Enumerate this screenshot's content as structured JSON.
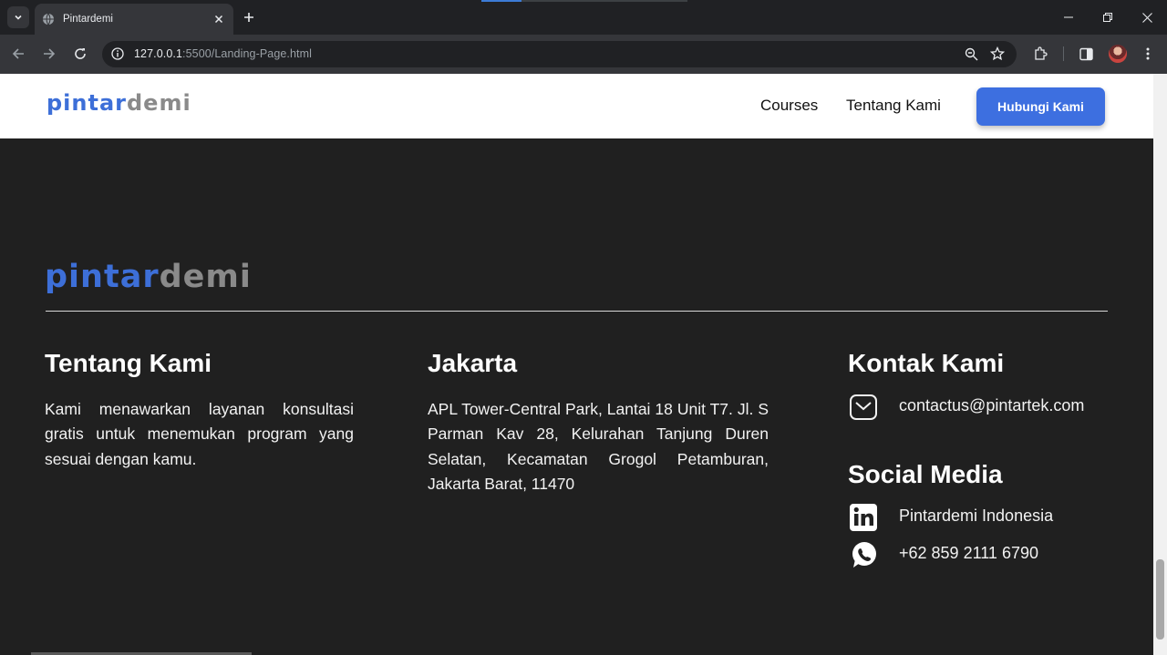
{
  "browser": {
    "tab_title": "Pintardemi",
    "url_host": "127.0.0.1",
    "url_rest": ":5500/Landing-Page.html"
  },
  "navbar": {
    "brand_part1": "pintar",
    "brand_part2": "demi",
    "links": [
      "Courses",
      "Tentang Kami"
    ],
    "cta": "Hubungi Kami"
  },
  "footer": {
    "brand_part1": "pintar",
    "brand_part2": "demi",
    "about": {
      "title": "Tentang Kami",
      "text": "Kami menawarkan layanan konsultasi gratis untuk menemukan program yang sesuai dengan kamu."
    },
    "location": {
      "title": "Jakarta",
      "text": "APL Tower-Central Park, Lantai 18 Unit T7. Jl. S Parman Kav 28, Kelurahan Tanjung Duren Selatan, Kecamatan Grogol Petamburan, Jakarta Barat, 11470"
    },
    "contact": {
      "title": "Kontak Kami",
      "email": "contactus@pintartek.com"
    },
    "social": {
      "title": "Social Media",
      "linkedin": "Pintardemi Indonesia",
      "whatsapp": "+62 859 2111 6790"
    }
  },
  "colors": {
    "brand_blue": "#3d6fd8",
    "brand_gray": "#8a8a8a",
    "footer_bg": "#202020",
    "cta_bg": "#3d6fe0"
  }
}
